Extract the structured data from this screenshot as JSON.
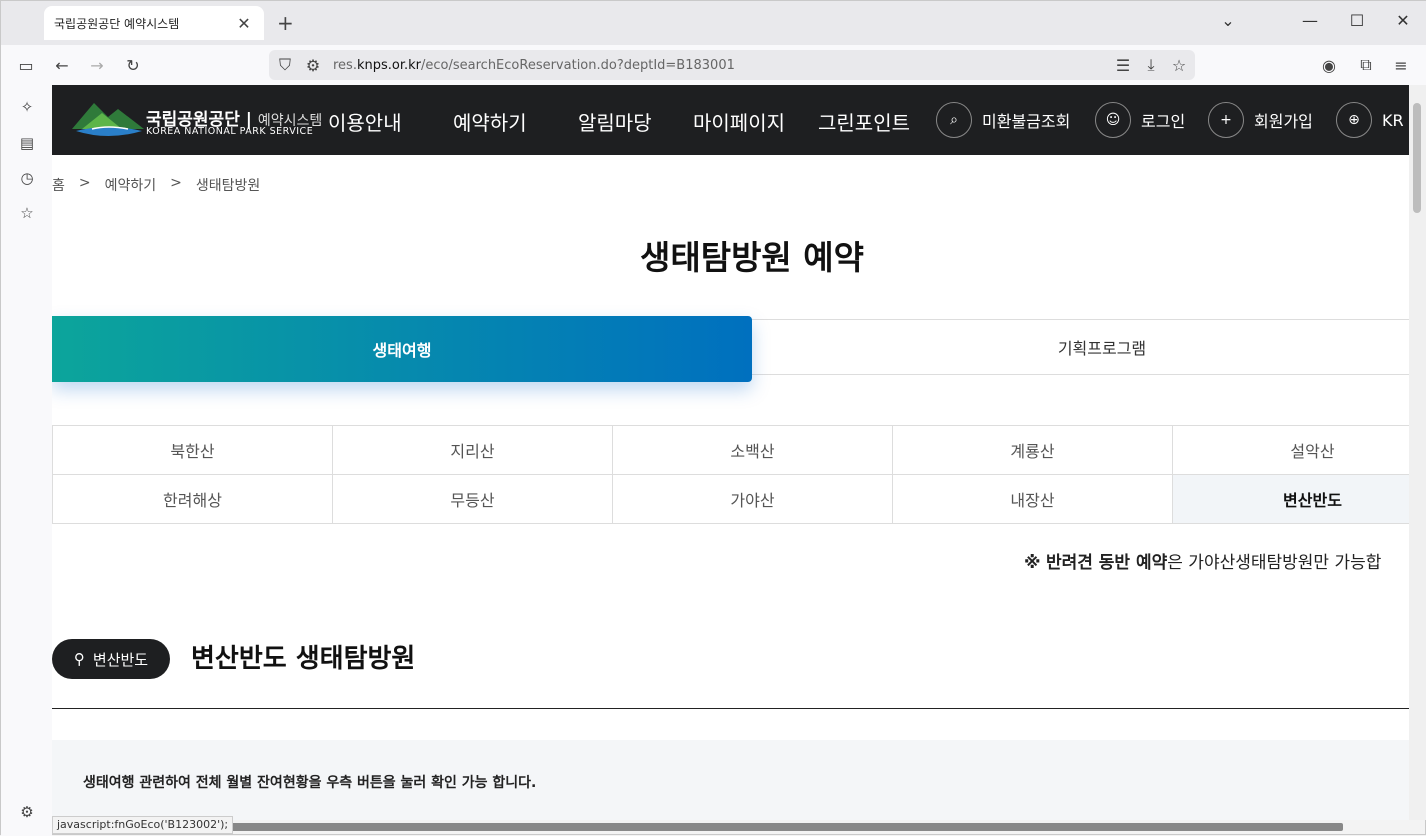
{
  "browser": {
    "tab_title": "국립공원공단 예약시스템",
    "tab_close": "✕",
    "new_tab": "+",
    "url_prefix": "res.",
    "url_domain": "knps.or.kr",
    "url_path": "/eco/searchEcoReservation.do?deptId=B183001",
    "status_text": "javascript:fnGoEco('B123002');"
  },
  "header": {
    "logo_kr": "국립공원공단",
    "logo_sub": "예약시스템",
    "logo_en": "KOREA NATIONAL PARK SERVICE",
    "nav": [
      "이용안내",
      "예약하기",
      "알림마당",
      "마이페이지",
      "그린포인트"
    ],
    "util": [
      "미환불금조회",
      "로그인",
      "회원가입",
      "KR"
    ]
  },
  "breadcrumb": [
    "홈",
    ">",
    "예약하기",
    ">",
    "생태탐방원"
  ],
  "page_title": "생태탐방원 예약",
  "tabs": {
    "active": "생태여행",
    "other": "기획프로그램"
  },
  "parks": {
    "row1": [
      "북한산",
      "지리산",
      "소백산",
      "계룡산",
      "설악산"
    ],
    "row2": [
      "한려해상",
      "무등산",
      "가야산",
      "내장산",
      "변산반도"
    ],
    "selected": "변산반도"
  },
  "notice": {
    "mark": "※",
    "bold": "반려견 동반 예약",
    "rest": "은 가야산생태탐방원만 가능합"
  },
  "section": {
    "badge": "변산반도",
    "title": "변산반도 생태탐방원"
  },
  "info_text": "생태여행 관련하여 전체 월별 잔여현황을 우측 버튼을 눌러 확인 가능 합니다.",
  "colors": {
    "header_bg": "#1e1f21",
    "tab_gradient_start": "#0ca59b",
    "tab_gradient_end": "#0070bf"
  }
}
